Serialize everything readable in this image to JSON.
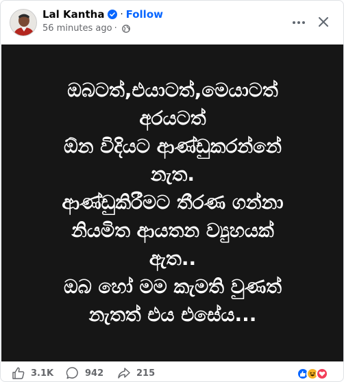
{
  "author": {
    "name": "Lal Kantha",
    "follow_label": "Follow",
    "separator": "·"
  },
  "meta": {
    "time": "56 minutes ago",
    "separator": "·",
    "privacy_icon": "globe-icon"
  },
  "post": {
    "lines": [
      "ඔබටත්,එයාටත්,මෙයාටත්",
      "අරයටත්",
      "ඕන විදියට ආණ්ඩුකරන්නේ",
      "නැත.",
      "ආණ්ඩුකිරීමට තීරණ ගන්නා",
      "නියමිත ආයතන ව්‍යුහයක්",
      "ඇත..",
      "ඔබ හෝ මම කැමති වුණත්",
      "නැතත් එය එසේය..."
    ],
    "background_color": "#161616"
  },
  "stats": {
    "likes": "3.1K",
    "comments": "942",
    "shares": "215"
  },
  "reactions": [
    "like",
    "haha",
    "love"
  ],
  "colors": {
    "accent": "#0866ff",
    "love": "#f33e58",
    "haha": "#f7b125"
  }
}
